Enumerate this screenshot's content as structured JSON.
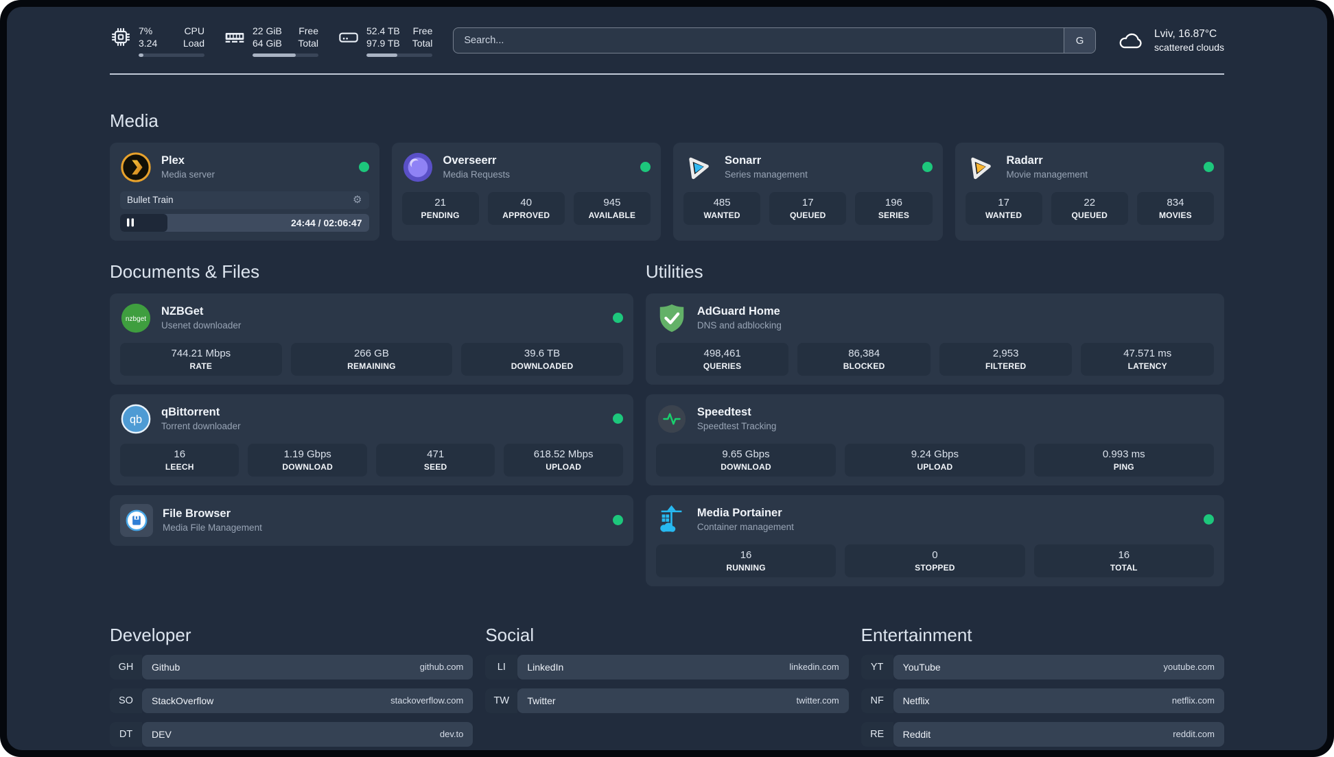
{
  "topbar": {
    "monitors": [
      {
        "icon": "cpu-icon",
        "value_top": "7%",
        "value_bottom": "3.24",
        "label_top": "CPU",
        "label_bottom": "Load",
        "progress": 7
      },
      {
        "icon": "ram-icon",
        "value_top": "22 GiB",
        "value_bottom": "64 GiB",
        "label_top": "Free",
        "label_bottom": "Total",
        "progress": 66
      },
      {
        "icon": "disk-icon",
        "value_top": "52.4 TB",
        "value_bottom": "97.9 TB",
        "label_top": "Free",
        "label_bottom": "Total",
        "progress": 47
      }
    ],
    "search": {
      "placeholder": "Search...",
      "engine": "G"
    },
    "weather": {
      "location_temp": "Lviv, 16.87°C",
      "condition": "scattered clouds"
    }
  },
  "media": {
    "heading": "Media",
    "plex": {
      "name": "Plex",
      "subtitle": "Media server",
      "icon": "plex-icon",
      "online": true,
      "player_title": "Bullet Train",
      "time": "24:44 / 02:06:47",
      "progress_pct": 19
    },
    "overseerr": {
      "name": "Overseerr",
      "subtitle": "Media Requests",
      "icon": "overseerr-icon",
      "online": true,
      "stats": [
        {
          "value": "21",
          "label": "PENDING"
        },
        {
          "value": "40",
          "label": "APPROVED"
        },
        {
          "value": "945",
          "label": "AVAILABLE"
        }
      ]
    },
    "sonarr": {
      "name": "Sonarr",
      "subtitle": "Series management",
      "icon": "sonarr-icon",
      "online": true,
      "stats": [
        {
          "value": "485",
          "label": "WANTED"
        },
        {
          "value": "17",
          "label": "QUEUED"
        },
        {
          "value": "196",
          "label": "SERIES"
        }
      ]
    },
    "radarr": {
      "name": "Radarr",
      "subtitle": "Movie management",
      "icon": "radarr-icon",
      "online": true,
      "stats": [
        {
          "value": "17",
          "label": "WANTED"
        },
        {
          "value": "22",
          "label": "QUEUED"
        },
        {
          "value": "834",
          "label": "MOVIES"
        }
      ]
    }
  },
  "documents": {
    "heading": "Documents & Files",
    "nzbget": {
      "name": "NZBGet",
      "subtitle": "Usenet downloader",
      "icon": "nzbget-icon",
      "online": true,
      "stats": [
        {
          "value": "744.21 Mbps",
          "label": "RATE"
        },
        {
          "value": "266 GB",
          "label": "REMAINING"
        },
        {
          "value": "39.6 TB",
          "label": "DOWNLOADED"
        }
      ]
    },
    "qbittorrent": {
      "name": "qBittorrent",
      "subtitle": "Torrent downloader",
      "icon": "qbittorrent-icon",
      "online": true,
      "stats": [
        {
          "value": "16",
          "label": "LEECH"
        },
        {
          "value": "1.19 Gbps",
          "label": "DOWNLOAD"
        },
        {
          "value": "471",
          "label": "SEED"
        },
        {
          "value": "618.52 Mbps",
          "label": "UPLOAD"
        }
      ]
    },
    "filebrowser": {
      "name": "File Browser",
      "subtitle": "Media File Management",
      "icon": "filebrowser-icon",
      "online": true
    }
  },
  "utilities": {
    "heading": "Utilities",
    "adguard": {
      "name": "AdGuard Home",
      "subtitle": "DNS and adblocking",
      "icon": "adguard-icon",
      "online": false,
      "stats": [
        {
          "value": "498,461",
          "label": "QUERIES"
        },
        {
          "value": "86,384",
          "label": "BLOCKED"
        },
        {
          "value": "2,953",
          "label": "FILTERED"
        },
        {
          "value": "47.571 ms",
          "label": "LATENCY"
        }
      ]
    },
    "speedtest": {
      "name": "Speedtest",
      "subtitle": "Speedtest Tracking",
      "icon": "speedtest-icon",
      "online": false,
      "stats": [
        {
          "value": "9.65 Gbps",
          "label": "DOWNLOAD"
        },
        {
          "value": "9.24 Gbps",
          "label": "UPLOAD"
        },
        {
          "value": "0.993 ms",
          "label": "PING"
        }
      ]
    },
    "portainer": {
      "name": "Media Portainer",
      "subtitle": "Container management",
      "icon": "portainer-icon",
      "online": true,
      "stats": [
        {
          "value": "16",
          "label": "RUNNING"
        },
        {
          "value": "0",
          "label": "STOPPED"
        },
        {
          "value": "16",
          "label": "TOTAL"
        }
      ]
    }
  },
  "bookmarks": {
    "developer": {
      "heading": "Developer",
      "items": [
        {
          "abbr": "GH",
          "name": "Github",
          "url": "github.com"
        },
        {
          "abbr": "SO",
          "name": "StackOverflow",
          "url": "stackoverflow.com"
        },
        {
          "abbr": "DT",
          "name": "DEV",
          "url": "dev.to"
        }
      ]
    },
    "social": {
      "heading": "Social",
      "items": [
        {
          "abbr": "LI",
          "name": "LinkedIn",
          "url": "linkedin.com"
        },
        {
          "abbr": "TW",
          "name": "Twitter",
          "url": "twitter.com"
        }
      ]
    },
    "entertainment": {
      "heading": "Entertainment",
      "items": [
        {
          "abbr": "YT",
          "name": "YouTube",
          "url": "youtube.com"
        },
        {
          "abbr": "NF",
          "name": "Netflix",
          "url": "netflix.com"
        },
        {
          "abbr": "RE",
          "name": "Reddit",
          "url": "reddit.com"
        }
      ]
    }
  },
  "colors": {
    "status_online": "#1dc77c",
    "background": "#212c3d",
    "card": "#2b3748"
  }
}
